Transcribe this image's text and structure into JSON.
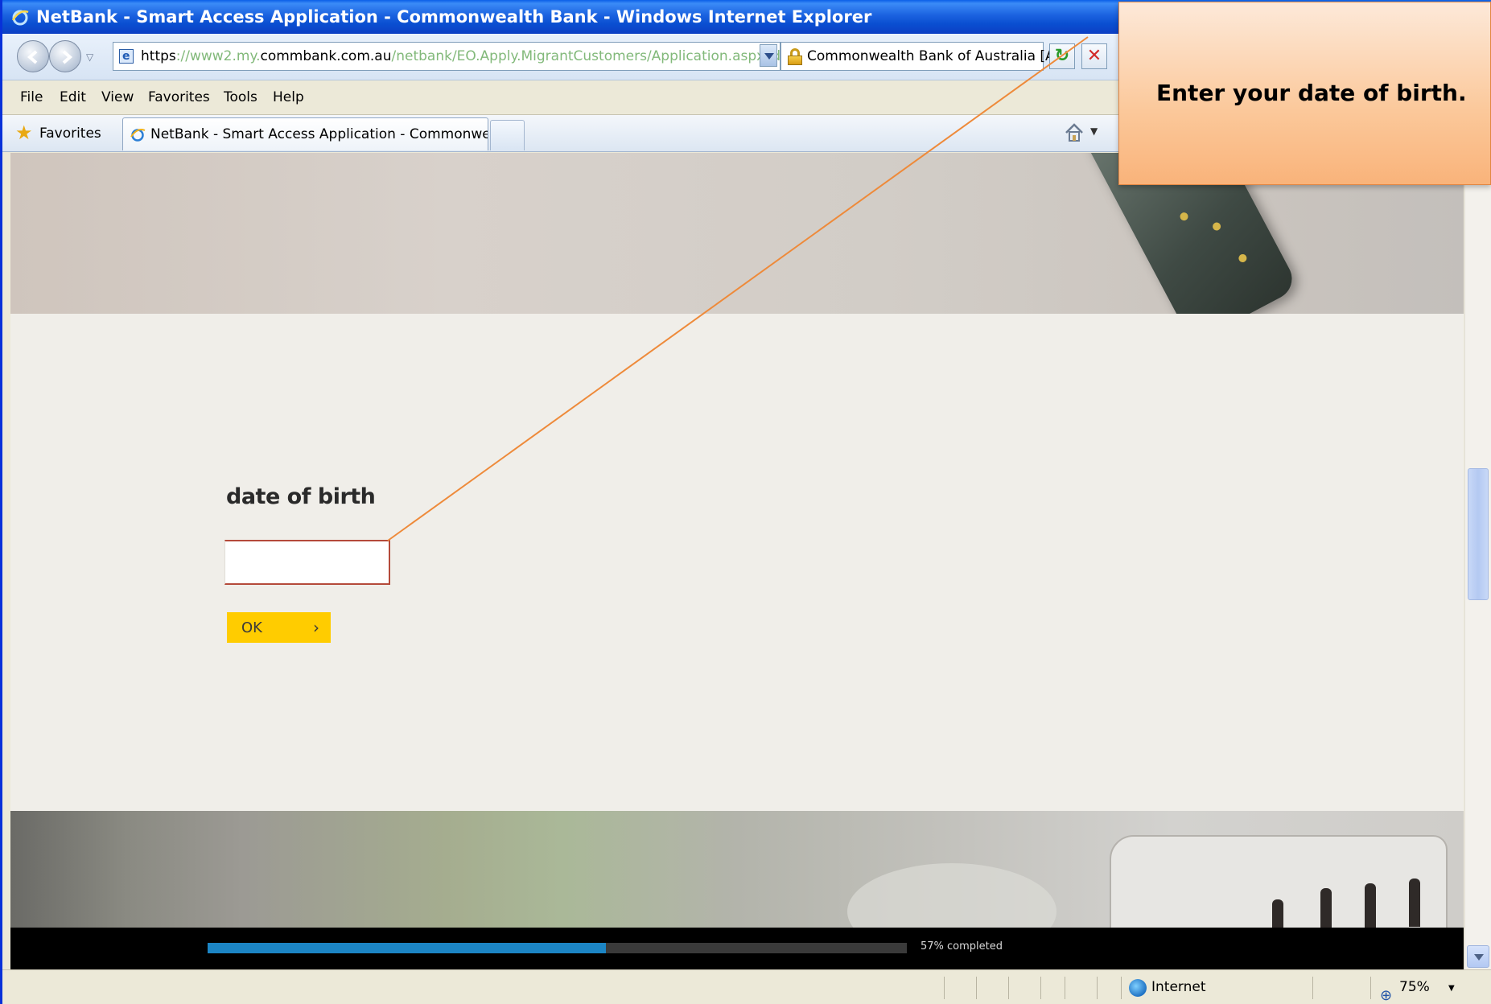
{
  "window": {
    "title": "NetBank - Smart Access Application - Commonwealth Bank - Windows Internet Explorer"
  },
  "address_bar": {
    "scheme": "https",
    "pre_domain": "://www2.my.",
    "domain": "commbank.com.au",
    "path": "/netbank/EO.Apply.MigrantCustomers/Application.aspx?dl=WMGAI",
    "cert_label": "Commonwealth Bank of Australia [AU]"
  },
  "menu": {
    "items": [
      "File",
      "Edit",
      "View",
      "Favorites",
      "Tools",
      "Help"
    ]
  },
  "favorites_bar": {
    "favorites_label": "Favorites",
    "tab_title": "NetBank - Smart Access Application - Commonwealth ..."
  },
  "form": {
    "dob_label": "date of birth",
    "dob_value": "",
    "ok_label": "OK",
    "ok_chevron": "›"
  },
  "progress": {
    "fraction": 0.57,
    "label": "57% completed"
  },
  "status_bar": {
    "zone": "Internet",
    "zoom": "75%"
  },
  "callout": {
    "text": "Enter your date of birth."
  },
  "colors": {
    "accent": "#ffcc00",
    "progress": "#1c85c4",
    "callout": "#fbc89a",
    "input_border": "#b44a3a"
  },
  "icons": [
    "ie-logo-icon",
    "back-icon",
    "forward-icon",
    "page-icon",
    "lock-icon",
    "refresh-icon",
    "stop-icon",
    "star-icon",
    "home-icon",
    "globe-icon",
    "zoom-icon"
  ]
}
